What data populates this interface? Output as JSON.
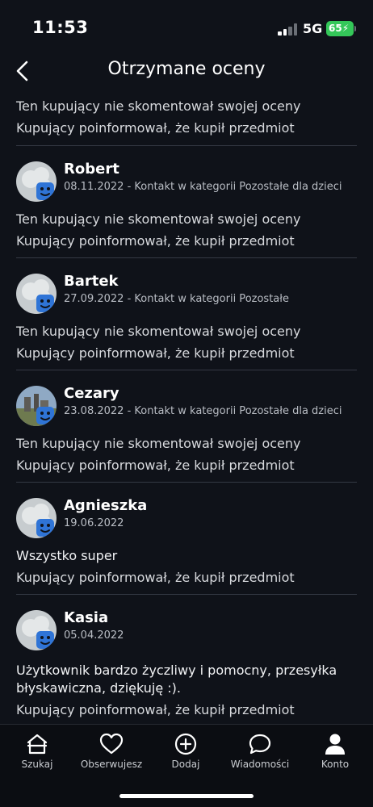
{
  "status_bar": {
    "time": "11:53",
    "network": "5G",
    "battery": "65"
  },
  "header": {
    "title": "Otrzymane oceny"
  },
  "top_partial": {
    "comment": "Ten kupujący nie skomentował swojej oceny",
    "note": "Kupujący poinformował, że kupił przedmiot"
  },
  "reviews": [
    {
      "name": "Robert",
      "meta": "08.11.2022 - Kontakt w kategorii Pozostałe dla dzieci",
      "comment": "Ten kupujący nie skomentował swojej oceny",
      "note": "Kupujący poinformował, że kupił przedmiot"
    },
    {
      "name": "Bartek",
      "meta": "27.09.2022 - Kontakt w kategorii Pozostałe",
      "comment": "Ten kupujący nie skomentował swojej oceny",
      "note": "Kupujący poinformował, że kupił przedmiot"
    },
    {
      "name": "Cezary",
      "meta": "23.08.2022 - Kontakt w kategorii Pozostałe dla dzieci",
      "comment": "Ten kupujący nie skomentował swojej oceny",
      "note": "Kupujący poinformował, że kupił przedmiot"
    },
    {
      "name": "Agnieszka",
      "meta": "19.06.2022",
      "comment": "Wszystko super",
      "note": "Kupujący poinformował, że kupił przedmiot"
    },
    {
      "name": "Kasia",
      "meta": "05.04.2022",
      "comment_line1": "Użytkownik bardzo życzliwy i pomocny, przesyłka",
      "comment_line2": "błyskawiczna, dziękuję :).",
      "note": "Kupujący poinformował, że kupił przedmiot"
    }
  ],
  "tabs": [
    {
      "label": "Szukaj",
      "icon": "home-icon"
    },
    {
      "label": "Obserwujesz",
      "icon": "heart-icon"
    },
    {
      "label": "Dodaj",
      "icon": "plus-circle-icon"
    },
    {
      "label": "Wiadomości",
      "icon": "chat-bubble-icon"
    },
    {
      "label": "Konto",
      "icon": "person-icon"
    }
  ],
  "colors": {
    "background": "#0f1219",
    "badge": "#2f74d6",
    "battery": "#34c759"
  }
}
